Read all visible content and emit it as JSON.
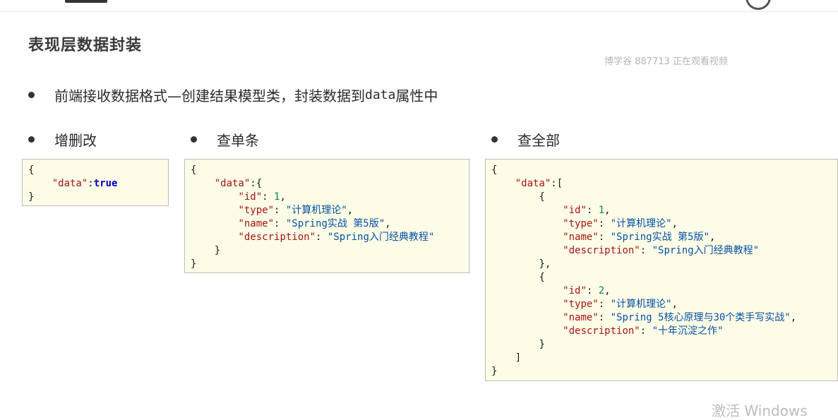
{
  "slide": {
    "title": "表现层数据封装",
    "watermark": "博学谷 887713 正在观看视频",
    "bullet_main_prefix": "前端接收数据格式—创建结果模型类，封装数据到",
    "bullet_main_code": "data",
    "bullet_main_suffix": "属性中",
    "section_labels": [
      "增删改",
      "查单条",
      "查全部"
    ]
  },
  "code": {
    "brace_open": "{",
    "brace_close": "}",
    "bracket_open": "[",
    "bracket_close": "]",
    "key_data": "\"data\"",
    "key_id": "\"id\"",
    "key_type": "\"type\"",
    "key_name": "\"name\"",
    "key_description": "\"description\"",
    "val_true": "true",
    "num_1": "1",
    "num_2": "2",
    "str_type": "\"计算机理论\"",
    "str_name_1": "\"Spring实战 第5版\"",
    "str_desc_1": "\"Spring入门经典教程\"",
    "str_name_2": "\"Spring 5核心原理与30个类手写实战\"",
    "str_desc_2": "\"十年沉淀之作\""
  },
  "os": {
    "activate_windows": "激活 Windows"
  }
}
